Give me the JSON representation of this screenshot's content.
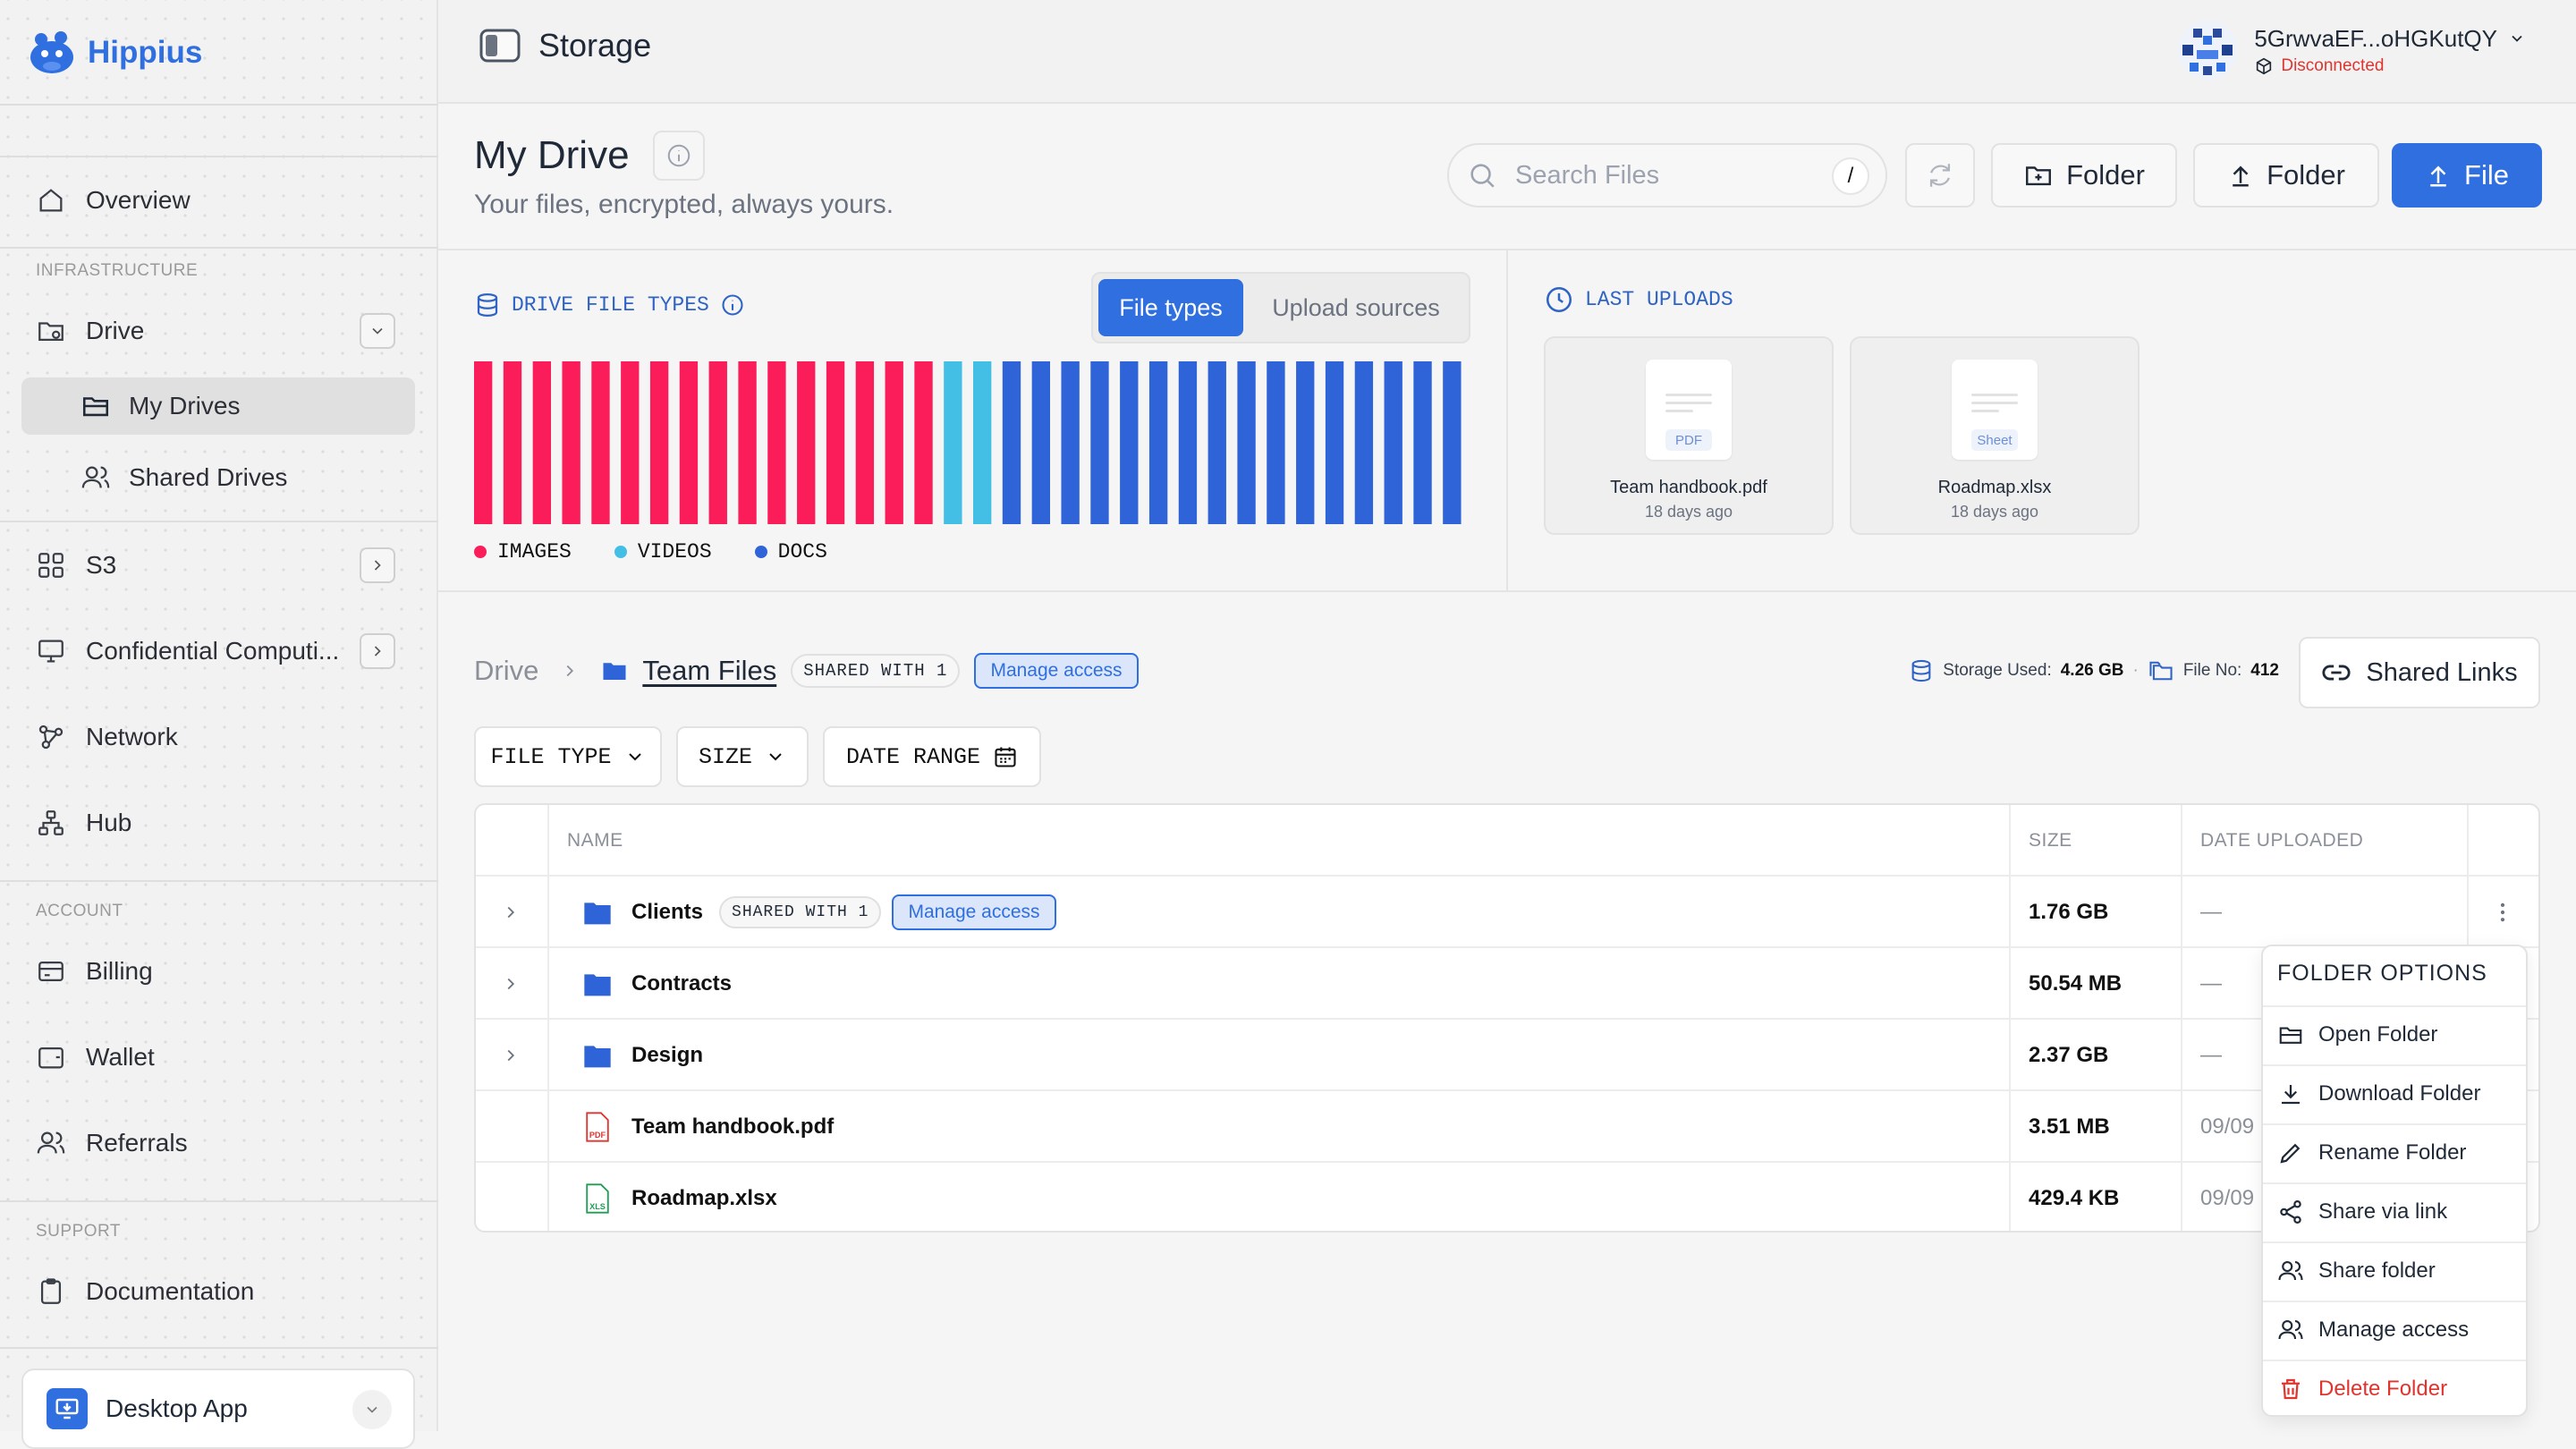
{
  "brand": {
    "name": "Hippius"
  },
  "sidebar": {
    "overview": "Overview",
    "section_infrastructure": "INFRASTRUCTURE",
    "drive": "Drive",
    "my_drives": "My Drives",
    "shared_drives": "Shared Drives",
    "s3": "S3",
    "confidential": "Confidential Computi...",
    "network": "Network",
    "hub": "Hub",
    "section_account": "ACCOUNT",
    "billing": "Billing",
    "wallet": "Wallet",
    "referrals": "Referrals",
    "section_support": "SUPPORT",
    "documentation": "Documentation",
    "desktop_app": "Desktop App"
  },
  "topbar": {
    "title": "Storage",
    "user_name": "5GrwvaEF...oHGKutQY",
    "user_status": "Disconnected"
  },
  "header": {
    "title": "My Drive",
    "subtitle": "Your files, encrypted, always yours.",
    "search_placeholder": "Search Files",
    "search_shortcut": "/",
    "new_folder": "Folder",
    "upload_folder": "Folder",
    "upload_file": "File"
  },
  "file_types": {
    "heading": "DRIVE FILE TYPES",
    "tab_active": "File types",
    "tab_inactive": "Upload sources",
    "legend": [
      {
        "label": "IMAGES",
        "color": "#fb1d5a"
      },
      {
        "label": "VIDEOS",
        "color": "#43bfe6"
      },
      {
        "label": "DOCS",
        "color": "#2f63d8"
      }
    ]
  },
  "chart_data": {
    "type": "bar",
    "title": "DRIVE FILE TYPES",
    "series": [
      {
        "name": "IMAGES",
        "count": 16,
        "color": "#fb1d5a"
      },
      {
        "name": "VIDEOS",
        "count": 2,
        "color": "#43bfe6"
      },
      {
        "name": "DOCS",
        "count": 16,
        "color": "#2f63d8"
      }
    ]
  },
  "last_uploads": {
    "heading": "LAST UPLOADS",
    "items": [
      {
        "name": "Team handbook.pdf",
        "date": "18 days ago",
        "badge": "PDF"
      },
      {
        "name": "Roadmap.xlsx",
        "date": "18 days ago",
        "badge": "Sheet"
      }
    ]
  },
  "breadcrumb": {
    "root": "Drive",
    "current": "Team Files",
    "shared": "SHARED WITH 1",
    "manage": "Manage access"
  },
  "storage": {
    "used_label": "Storage Used:",
    "used_value": "4.26 GB",
    "separator": "·",
    "files_label": "File No:",
    "files_value": "412",
    "shared_links": "Shared Links"
  },
  "filters": {
    "file_type": "FILE TYPE",
    "size": "SIZE",
    "date_range": "DATE RANGE"
  },
  "table": {
    "headers": {
      "name": "NAME",
      "size": "SIZE",
      "date": "DATE UPLOADED"
    },
    "rows": [
      {
        "name": "Clients",
        "size": "1.76 GB",
        "date": "—",
        "shared": "SHARED WITH 1",
        "manage": "Manage access"
      },
      {
        "name": "Contracts",
        "size": "50.54 MB",
        "date": "—"
      },
      {
        "name": "Design",
        "size": "2.37 GB",
        "date": "—"
      },
      {
        "name": "Team handbook.pdf",
        "size": "3.51 MB",
        "date": "09/09"
      },
      {
        "name": "Roadmap.xlsx",
        "size": "429.4 KB",
        "date": "09/09"
      }
    ]
  },
  "folder_menu": {
    "title": "FOLDER OPTIONS",
    "items": [
      "Open Folder",
      "Download Folder",
      "Rename Folder",
      "Share via link",
      "Share folder",
      "Manage access",
      "Delete Folder"
    ]
  }
}
